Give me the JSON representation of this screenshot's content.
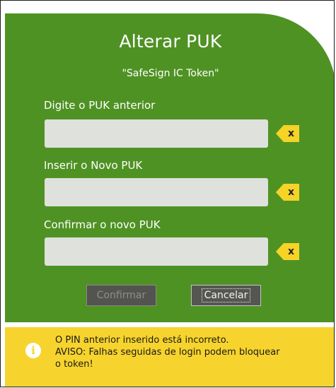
{
  "dialog": {
    "title": "Alterar PUK",
    "subtitle": "\"SafeSign IC Token\""
  },
  "fields": [
    {
      "label": "Digite o PUK anterior",
      "value": "",
      "clear_label": "x"
    },
    {
      "label": "Inserir o Novo PUK",
      "value": "",
      "clear_label": "x"
    },
    {
      "label": "Confirmar o novo PUK",
      "value": "",
      "clear_label": "x"
    }
  ],
  "buttons": {
    "confirm_label": "Confirmar",
    "cancel_label": "Cancelar"
  },
  "alert": {
    "icon": "info-icon",
    "lines": [
      "O PIN anterior inserido está incorreto.",
      "AVISO: Falhas seguidas de login podem bloquear",
      "o token!"
    ]
  },
  "colors": {
    "panel_green": "#4f9224",
    "alert_yellow": "#f7d42d",
    "clear_button_yellow": "#f5d327"
  }
}
